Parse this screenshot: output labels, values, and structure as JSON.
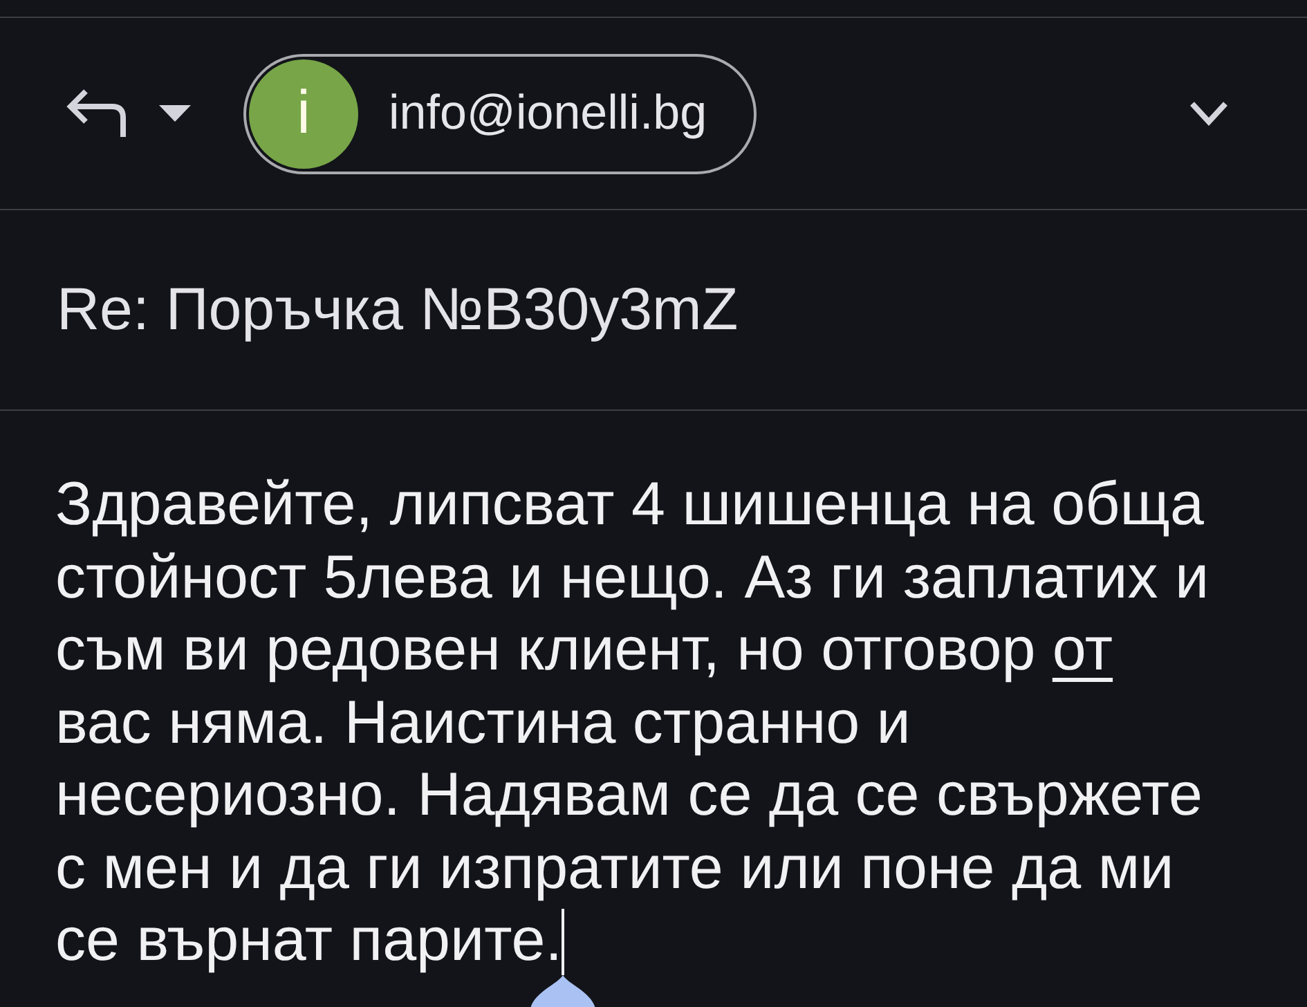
{
  "recipient": {
    "avatar_letter": "i",
    "email": "info@ionelli.bg"
  },
  "subject": {
    "value": "Re: Поръчка №B30y3mZ"
  },
  "body": {
    "segments": [
      {
        "text": "Здравейте, липсват 4 шишенца на обща стойност 5лева и нещо. Аз ги заплатих и съм ви редовен клиент, но отговор ",
        "composing": false
      },
      {
        "text": "от",
        "composing": true
      },
      {
        "text": " вас няма. Наистина странно и несериозно. Надявам се да се свържете с мен и да ги изпратите или поне да ми се върнат парите.",
        "composing": false
      }
    ],
    "cursor": true
  }
}
